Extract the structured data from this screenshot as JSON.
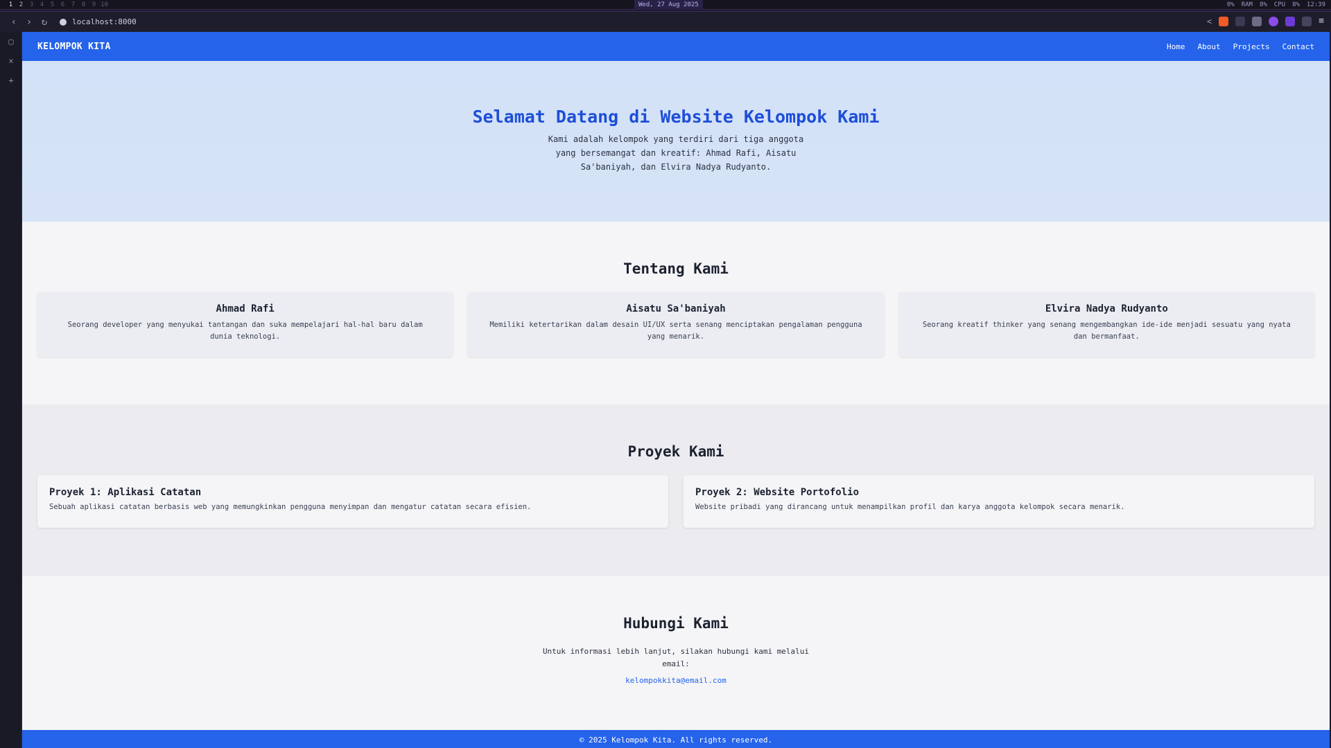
{
  "system": {
    "workspaces": [
      "1",
      "2",
      "3",
      "4",
      "5",
      "6",
      "7",
      "8",
      "9",
      "10"
    ],
    "date": "Wed, 27 Aug 2025",
    "status": [
      "0%",
      "RAM",
      "8%",
      "CPU",
      "8%",
      "12:39"
    ]
  },
  "browser": {
    "url": "localhost:8000"
  },
  "site": {
    "brand": "KELOMPOK KITA",
    "nav": [
      "Home",
      "About",
      "Projects",
      "Contact"
    ],
    "hero": {
      "title": "Selamat Datang di Website Kelompok Kami",
      "text": "Kami adalah kelompok yang terdiri dari tiga anggota yang bersemangat dan kreatif: Ahmad Rafi, Aisatu Sa'baniyah, dan Elvira Nadya Rudyanto."
    },
    "about": {
      "title": "Tentang Kami",
      "members": [
        {
          "name": "Ahmad Rafi",
          "desc": "Seorang developer yang menyukai tantangan dan suka mempelajari hal-hal baru dalam dunia teknologi."
        },
        {
          "name": "Aisatu Sa'baniyah",
          "desc": "Memiliki ketertarikan dalam desain UI/UX serta senang menciptakan pengalaman pengguna yang menarik."
        },
        {
          "name": "Elvira Nadya Rudyanto",
          "desc": "Seorang kreatif thinker yang senang mengembangkan ide-ide menjadi sesuatu yang nyata dan bermanfaat."
        }
      ]
    },
    "projects": {
      "title": "Proyek Kami",
      "items": [
        {
          "title": "Proyek 1: Aplikasi Catatan",
          "desc": "Sebuah aplikasi catatan berbasis web yang memungkinkan pengguna menyimpan dan mengatur catatan secara efisien."
        },
        {
          "title": "Proyek 2: Website Portofolio",
          "desc": "Website pribadi yang dirancang untuk menampilkan profil dan karya anggota kelompok secara menarik."
        }
      ]
    },
    "contact": {
      "title": "Hubungi Kami",
      "text": "Untuk informasi lebih lanjut, silakan hubungi kami melalui email:",
      "email": "kelompokkita@email.com"
    },
    "footer": "© 2025 Kelompok Kita. All rights reserved."
  }
}
